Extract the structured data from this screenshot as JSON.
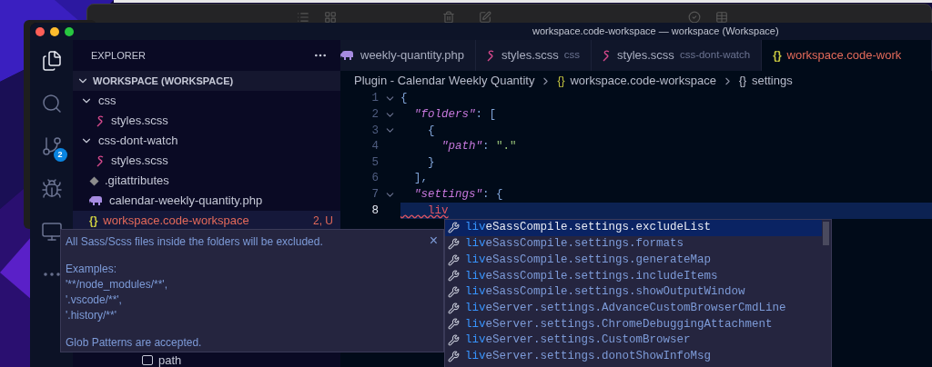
{
  "window": {
    "title": "workspace.code-workspace — workspace (Workspace)"
  },
  "activity_bar": [
    {
      "kind": "explorer",
      "selected": true
    },
    {
      "kind": "search",
      "selected": false
    },
    {
      "kind": "source_control",
      "selected": false,
      "badge": "2"
    },
    {
      "kind": "run",
      "selected": false
    },
    {
      "kind": "remote",
      "selected": false
    },
    {
      "kind": "more",
      "selected": false
    }
  ],
  "sidebar": {
    "title": "EXPLORER",
    "section": {
      "label": "WORKSPACE (WORKSPACE)",
      "expanded": true,
      "children": [
        {
          "label": "css",
          "kind": "folder",
          "expanded": true,
          "selected": false,
          "children": [
            {
              "label": "styles.scss",
              "kind": "scss",
              "selected": false
            }
          ]
        },
        {
          "label": "css-dont-watch",
          "kind": "folder",
          "expanded": true,
          "selected": false,
          "children": [
            {
              "label": "styles.scss",
              "kind": "scss",
              "selected": false
            }
          ]
        },
        {
          "label": ".gitattributes",
          "kind": "git",
          "selected": false
        },
        {
          "label": "calendar-weekly-quantity.php",
          "kind": "php",
          "selected": false
        },
        {
          "label": "workspace.code-workspace",
          "kind": "json",
          "icon": "{}",
          "selected": true,
          "badge": "2, U"
        }
      ]
    },
    "outline_item": {
      "label": "path"
    }
  },
  "tabs": [
    {
      "label": "weekly-quantity.php",
      "kind": "php",
      "selected": false
    },
    {
      "label": "styles.scss",
      "description": "css",
      "kind": "scss",
      "selected": false
    },
    {
      "label": "styles.scss",
      "description": "css-dont-watch",
      "kind": "scss",
      "selected": false
    },
    {
      "label": "workspace.code-work",
      "kind": "json",
      "icon": "{}",
      "selected": true
    }
  ],
  "breadcrumbs": [
    {
      "label": "Plugin - Calendar Weekly Quantity"
    },
    {
      "label": "workspace.code-workspace",
      "icon": "{}",
      "kind": "json"
    },
    {
      "label": "settings",
      "icon": "{}",
      "kind": "object"
    }
  ],
  "code_lines": [
    {
      "number": "1",
      "fold": true,
      "current": false,
      "tokens": [
        {
          "kind": "punct",
          "text": "{"
        }
      ]
    },
    {
      "number": "2",
      "fold": true,
      "current": false,
      "tokens": [
        {
          "kind": "key",
          "text": "  \"folders\""
        },
        {
          "kind": "punct",
          "text": ": ["
        }
      ]
    },
    {
      "number": "3",
      "fold": true,
      "current": false,
      "tokens": [
        {
          "kind": "punct",
          "text": "    {"
        }
      ]
    },
    {
      "number": "4",
      "fold": false,
      "current": false,
      "tokens": [
        {
          "kind": "key",
          "text": "      \"path\""
        },
        {
          "kind": "punct",
          "text": ": "
        },
        {
          "kind": "string",
          "text": "\".\""
        }
      ]
    },
    {
      "number": "5",
      "fold": false,
      "current": false,
      "tokens": [
        {
          "kind": "punct",
          "text": "    }"
        }
      ]
    },
    {
      "number": "6",
      "fold": false,
      "current": false,
      "tokens": [
        {
          "kind": "punct",
          "text": "  ],"
        }
      ]
    },
    {
      "number": "7",
      "fold": true,
      "current": false,
      "tokens": [
        {
          "kind": "key",
          "text": "  \"settings\""
        },
        {
          "kind": "punct",
          "text": ": {"
        }
      ]
    },
    {
      "number": "8",
      "fold": false,
      "current": true,
      "tokens": [
        {
          "kind": "error",
          "text": "    liv"
        }
      ]
    }
  ],
  "hover": {
    "paragraphs": [
      "All Sass/Scss files inside the folders will be excluded.",
      "Examples:\n'**/node_modules/**',\n'.vscode/**',\n'.history/**'",
      "Glob Patterns are accepted."
    ],
    "close": "×"
  },
  "suggestions": [
    {
      "label": "**liv**eSassCompile.settings.excludeList",
      "selected": true
    },
    {
      "label": "**liv**eSassCompile.settings.formats",
      "selected": false
    },
    {
      "label": "**liv**eSassCompile.settings.generateMap",
      "selected": false
    },
    {
      "label": "**liv**eSassCompile.settings.includeItems",
      "selected": false
    },
    {
      "label": "**liv**eSassCompile.settings.showOutputWindow",
      "selected": false
    },
    {
      "label": "**liv**eServer.settings.AdvanceCustomBrowserCmdLine",
      "selected": false
    },
    {
      "label": "**liv**eServer.settings.ChromeDebuggingAttachment",
      "selected": false
    },
    {
      "label": "**liv**eServer.settings.CustomBrowser",
      "selected": false
    },
    {
      "label": "**liv**eServer.settings.donotShowInfoMsg",
      "selected": false
    }
  ]
}
